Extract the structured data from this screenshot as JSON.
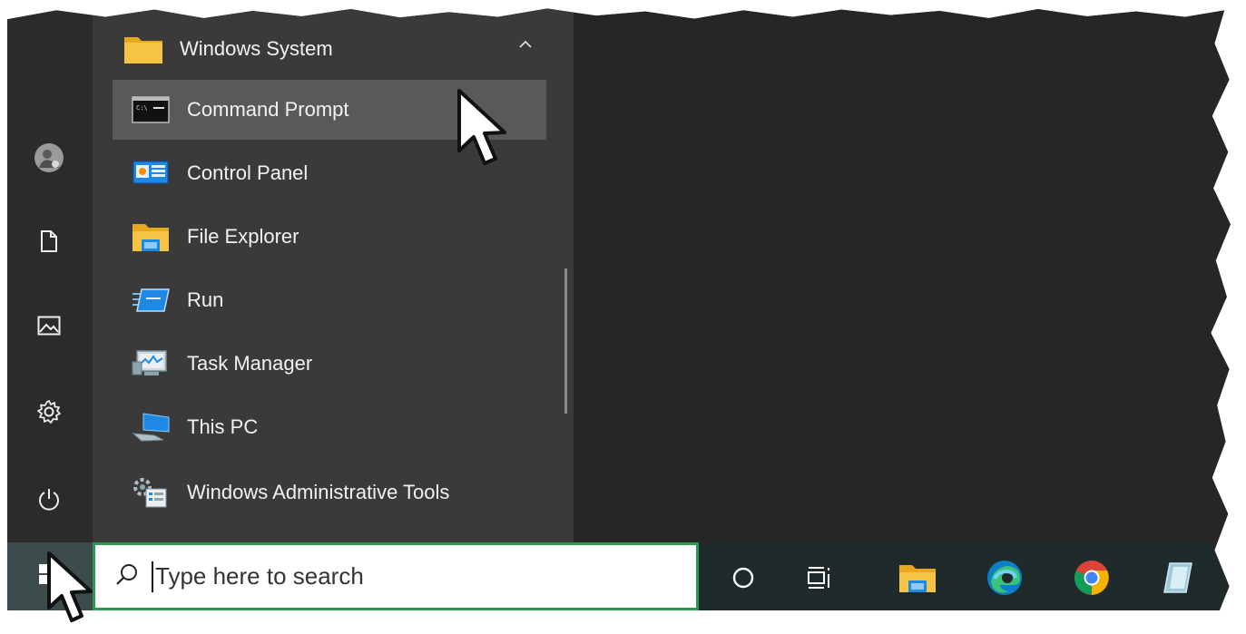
{
  "start_menu": {
    "group": {
      "label": "Windows System",
      "icon": "folder-icon",
      "expanded": true
    },
    "items": [
      {
        "label": "Command Prompt",
        "icon": "command-prompt-icon",
        "hovered": true
      },
      {
        "label": "Control Panel",
        "icon": "control-panel-icon"
      },
      {
        "label": "File Explorer",
        "icon": "file-explorer-icon"
      },
      {
        "label": "Run",
        "icon": "run-icon"
      },
      {
        "label": "Task Manager",
        "icon": "task-manager-icon"
      },
      {
        "label": "This PC",
        "icon": "this-pc-icon"
      },
      {
        "label": "Windows Administrative Tools",
        "icon": "admin-tools-icon"
      }
    ],
    "rail": [
      "user-avatar-icon",
      "documents-icon",
      "pictures-icon",
      "settings-gear-icon",
      "power-icon"
    ]
  },
  "taskbar": {
    "search": {
      "placeholder": "Type here to search"
    },
    "icons": [
      "start-windows-icon",
      "cortana-circle-icon",
      "task-view-icon",
      "file-explorer-icon",
      "edge-icon",
      "chrome-icon",
      "notepad-app-icon"
    ]
  },
  "colors": {
    "search_border": "#2a9a52",
    "folder": "#f6c445",
    "accent_blue": "#1e88e5"
  }
}
